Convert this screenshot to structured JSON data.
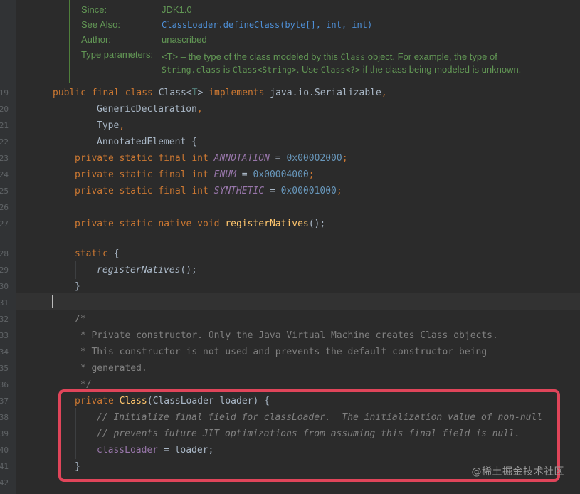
{
  "doc_popup": {
    "rows": [
      {
        "label": "Since:",
        "value": "JDK1.0"
      },
      {
        "label": "See Also:",
        "value": "ClassLoader.defineClass(byte[], int, int)"
      },
      {
        "label": "Author:",
        "value": "unascribed"
      },
      {
        "label": "Type parameters:",
        "value_line1_prefix": "<T> – the type of the class modeled by this ",
        "value_line1_code": "Class",
        "value_line1_suffix": " object. For example, the type of",
        "value_line2_code1": "String.class",
        "value_line2_mid1": " is ",
        "value_line2_code2": "Class<String>",
        "value_line2_mid2": ". Use ",
        "value_line2_code3": "Class<?>",
        "value_line2_suffix": " if the class being modeled is unknown."
      }
    ]
  },
  "line_numbers": [
    "19",
    "20",
    "21",
    "22",
    "23",
    "24",
    "25",
    "26",
    "27",
    "28",
    "29",
    "30",
    "31",
    "32",
    "33",
    "34",
    "35",
    "36",
    "37",
    "38",
    "39",
    "40",
    "41",
    "42"
  ],
  "code": {
    "l19": {
      "a": "public final class ",
      "b": "Class<",
      "c": "T",
      "d": "> ",
      "e": "implements ",
      "f": "java.io.Serializable",
      "g": ","
    },
    "l20": {
      "a": "GenericDeclaration",
      "b": ","
    },
    "l21": {
      "a": "Type",
      "b": ","
    },
    "l22": {
      "a": "AnnotatedElement {"
    },
    "l23": {
      "a": "private static final int ",
      "b": "ANNOTATION",
      "c": " = ",
      "d": "0x00002000",
      "e": ";"
    },
    "l24": {
      "a": "private static final int ",
      "b": "ENUM",
      "c": " = ",
      "d": "0x00004000",
      "e": ";"
    },
    "l25": {
      "a": "private static final int ",
      "b": "SYNTHETIC",
      "c": " = ",
      "d": "0x00001000",
      "e": ";"
    },
    "l27": {
      "a": "private static native void ",
      "b": "registerNatives",
      "c": "();"
    },
    "l28": {
      "a": "static ",
      "b": "{"
    },
    "l29": {
      "a": "registerNatives",
      "b": "();"
    },
    "l30": {
      "a": "}"
    },
    "l32": {
      "a": "/*"
    },
    "l33": {
      "a": " * Private constructor. Only the Java Virtual Machine creates Class objects."
    },
    "l34": {
      "a": " * This constructor is not used and prevents the default constructor being"
    },
    "l35": {
      "a": " * generated."
    },
    "l36": {
      "a": " */"
    },
    "l37": {
      "a": "private ",
      "b": "Class",
      "c": "(ClassLoader loader) {"
    },
    "l38": {
      "a": "// Initialize final field for classLoader.  The initialization value of non-null"
    },
    "l39": {
      "a": "// prevents future JIT optimizations from assuming this final field is null."
    },
    "l40": {
      "a": "classLoader",
      "b": " = loader;"
    },
    "l41": {
      "a": "}"
    }
  },
  "watermark": "@稀土掘金技术社区",
  "colors": {
    "background": "#2b2b2b",
    "keyword": "#cc7832",
    "field": "#9876aa",
    "number": "#6897bb",
    "method": "#ffc66d",
    "comment": "#808080",
    "highlight_border": "#e0455a"
  }
}
